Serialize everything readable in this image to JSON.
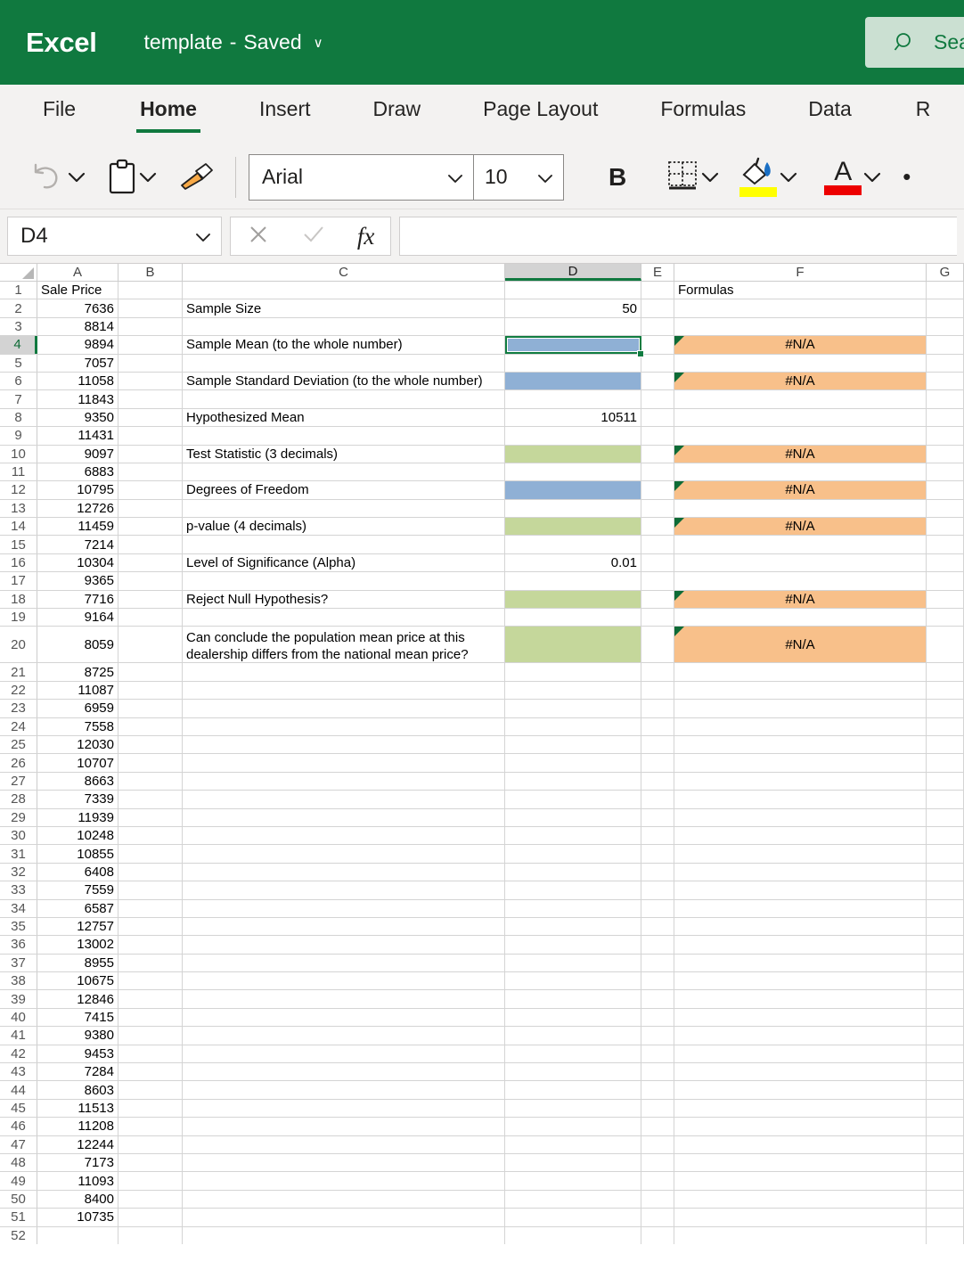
{
  "titlebar": {
    "app": "Excel",
    "doc_name": "template",
    "dash": "-",
    "saved": "Saved",
    "chevron": "∨",
    "search_placeholder": "Search",
    "search_icon": "search-icon",
    "brand_color": "#10793F"
  },
  "ribbon": {
    "tabs": [
      {
        "label": "File",
        "active": false
      },
      {
        "label": "Home",
        "active": true
      },
      {
        "label": "Insert",
        "active": false
      },
      {
        "label": "Draw",
        "active": false
      },
      {
        "label": "Page Layout",
        "active": false
      },
      {
        "label": "Formulas",
        "active": false
      },
      {
        "label": "Data",
        "active": false
      },
      {
        "label": "R",
        "active": false
      }
    ]
  },
  "toolbar": {
    "undo_icon": "undo-icon",
    "undo_chevron": "∨",
    "paste_icon": "paste-clipboard-icon",
    "paste_chevron": "∨",
    "format_painter_icon": "format-painter-icon",
    "font_name": "Arial",
    "font_name_chevron": "∨",
    "font_size": "10",
    "font_size_chevron": "∨",
    "bold_label": "B",
    "borders_icon": "borders-icon",
    "borders_chevron": "∨",
    "fill_color_icon": "fill-color-icon",
    "fill_color_chevron": "∨",
    "fill_color_swatch": "#FFFF00",
    "font_color_label": "A",
    "font_color_chevron": "∨",
    "font_color_swatch": "#ED0000",
    "more_label": "•"
  },
  "formula_bar": {
    "name_box_value": "D4",
    "name_box_chevron": "∨",
    "cancel_icon": "cancel-x-icon",
    "confirm_icon": "confirm-check-icon",
    "fx_label": "fx",
    "formula_value": ""
  },
  "grid": {
    "columns": [
      "A",
      "B",
      "C",
      "D",
      "E",
      "F",
      "G"
    ],
    "selected_column": "D",
    "selected_row": "4",
    "selected_cell": "D4",
    "colors": {
      "input_blue": "#8FB0D5",
      "input_green": "#C5D79B",
      "formula_orange": "#F8C08A",
      "selection_green": "#107C41"
    },
    "rows": [
      {
        "n": "1",
        "a": "Sale Price",
        "c": "",
        "d": "",
        "f": "Formulas"
      },
      {
        "n": "2",
        "a": "7636",
        "c": "Sample Size",
        "d": "50",
        "f": ""
      },
      {
        "n": "3",
        "a": "8814",
        "c": "",
        "d": "",
        "f": ""
      },
      {
        "n": "4",
        "a": "9894",
        "c": "Sample Mean (to the whole number)",
        "d": "",
        "d_fill": "blue",
        "f": "#N/A",
        "f_fill": "orange",
        "f_err": true
      },
      {
        "n": "5",
        "a": "7057",
        "c": "",
        "d": "",
        "f": ""
      },
      {
        "n": "6",
        "a": "11058",
        "c": "Sample Standard Deviation (to the whole number)",
        "d": "",
        "d_fill": "blue",
        "f": "#N/A",
        "f_fill": "orange",
        "f_err": true
      },
      {
        "n": "7",
        "a": "11843",
        "c": "",
        "d": "",
        "f": ""
      },
      {
        "n": "8",
        "a": "9350",
        "c": "Hypothesized Mean",
        "d": "10511",
        "f": ""
      },
      {
        "n": "9",
        "a": "11431",
        "c": "",
        "d": "",
        "f": ""
      },
      {
        "n": "10",
        "a": "9097",
        "c": "Test Statistic (3 decimals)",
        "d": "",
        "d_fill": "green",
        "f": "#N/A",
        "f_fill": "orange",
        "f_err": true
      },
      {
        "n": "11",
        "a": "6883",
        "c": "",
        "d": "",
        "f": ""
      },
      {
        "n": "12",
        "a": "10795",
        "c": "Degrees of Freedom",
        "d": "",
        "d_fill": "blue",
        "f": "#N/A",
        "f_fill": "orange",
        "f_err": true
      },
      {
        "n": "13",
        "a": "12726",
        "c": "",
        "d": "",
        "f": ""
      },
      {
        "n": "14",
        "a": "11459",
        "c": "p-value (4 decimals)",
        "d": "",
        "d_fill": "green",
        "f": "#N/A",
        "f_fill": "orange",
        "f_err": true
      },
      {
        "n": "15",
        "a": "7214",
        "c": "",
        "d": "",
        "f": ""
      },
      {
        "n": "16",
        "a": "10304",
        "c": "Level of Significance (Alpha)",
        "d": "0.01",
        "f": ""
      },
      {
        "n": "17",
        "a": "9365",
        "c": "",
        "d": "",
        "f": ""
      },
      {
        "n": "18",
        "a": "7716",
        "c": "Reject Null Hypothesis?",
        "d": "",
        "d_fill": "green",
        "f": "#N/A",
        "f_fill": "orange",
        "f_err": true
      },
      {
        "n": "19",
        "a": "9164",
        "c": "",
        "d": "",
        "f": ""
      },
      {
        "n": "20",
        "a": "8059",
        "c": "Can conclude the population mean price at this dealership differs from the national mean price?",
        "d": "",
        "d_fill": "green",
        "f": "#N/A",
        "f_fill": "orange",
        "f_err": true,
        "tall": true
      },
      {
        "n": "21",
        "a": "8725",
        "c": "",
        "d": "",
        "f": ""
      },
      {
        "n": "22",
        "a": "11087",
        "c": "",
        "d": "",
        "f": ""
      },
      {
        "n": "23",
        "a": "6959",
        "c": "",
        "d": "",
        "f": ""
      },
      {
        "n": "24",
        "a": "7558",
        "c": "",
        "d": "",
        "f": ""
      },
      {
        "n": "25",
        "a": "12030",
        "c": "",
        "d": "",
        "f": ""
      },
      {
        "n": "26",
        "a": "10707",
        "c": "",
        "d": "",
        "f": ""
      },
      {
        "n": "27",
        "a": "8663",
        "c": "",
        "d": "",
        "f": ""
      },
      {
        "n": "28",
        "a": "7339",
        "c": "",
        "d": "",
        "f": ""
      },
      {
        "n": "29",
        "a": "11939",
        "c": "",
        "d": "",
        "f": ""
      },
      {
        "n": "30",
        "a": "10248",
        "c": "",
        "d": "",
        "f": ""
      },
      {
        "n": "31",
        "a": "10855",
        "c": "",
        "d": "",
        "f": ""
      },
      {
        "n": "32",
        "a": "6408",
        "c": "",
        "d": "",
        "f": ""
      },
      {
        "n": "33",
        "a": "7559",
        "c": "",
        "d": "",
        "f": ""
      },
      {
        "n": "34",
        "a": "6587",
        "c": "",
        "d": "",
        "f": ""
      },
      {
        "n": "35",
        "a": "12757",
        "c": "",
        "d": "",
        "f": ""
      },
      {
        "n": "36",
        "a": "13002",
        "c": "",
        "d": "",
        "f": ""
      },
      {
        "n": "37",
        "a": "8955",
        "c": "",
        "d": "",
        "f": ""
      },
      {
        "n": "38",
        "a": "10675",
        "c": "",
        "d": "",
        "f": ""
      },
      {
        "n": "39",
        "a": "12846",
        "c": "",
        "d": "",
        "f": ""
      },
      {
        "n": "40",
        "a": "7415",
        "c": "",
        "d": "",
        "f": ""
      },
      {
        "n": "41",
        "a": "9380",
        "c": "",
        "d": "",
        "f": ""
      },
      {
        "n": "42",
        "a": "9453",
        "c": "",
        "d": "",
        "f": ""
      },
      {
        "n": "43",
        "a": "7284",
        "c": "",
        "d": "",
        "f": ""
      },
      {
        "n": "44",
        "a": "8603",
        "c": "",
        "d": "",
        "f": ""
      },
      {
        "n": "45",
        "a": "11513",
        "c": "",
        "d": "",
        "f": ""
      },
      {
        "n": "46",
        "a": "11208",
        "c": "",
        "d": "",
        "f": ""
      },
      {
        "n": "47",
        "a": "12244",
        "c": "",
        "d": "",
        "f": ""
      },
      {
        "n": "48",
        "a": "7173",
        "c": "",
        "d": "",
        "f": ""
      },
      {
        "n": "49",
        "a": "11093",
        "c": "",
        "d": "",
        "f": ""
      },
      {
        "n": "50",
        "a": "8400",
        "c": "",
        "d": "",
        "f": ""
      },
      {
        "n": "51",
        "a": "10735",
        "c": "",
        "d": "",
        "f": ""
      },
      {
        "n": "52",
        "a": "",
        "c": "",
        "d": "",
        "f": ""
      }
    ]
  }
}
